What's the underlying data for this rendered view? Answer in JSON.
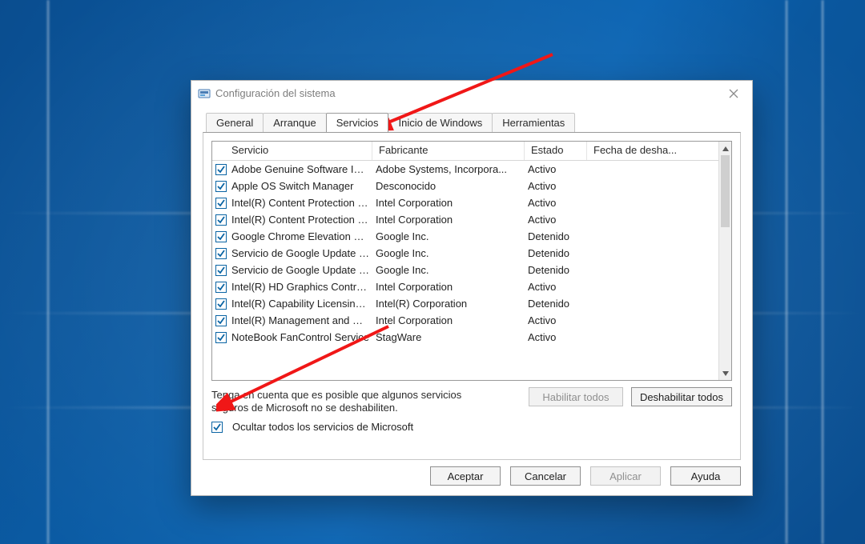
{
  "window": {
    "title": "Configuración del sistema"
  },
  "tabs": [
    "General",
    "Arranque",
    "Servicios",
    "Inicio de Windows",
    "Herramientas"
  ],
  "active_tab_index": 2,
  "columns": {
    "service": "Servicio",
    "manufacturer": "Fabricante",
    "state": "Estado",
    "date": "Fecha de desha..."
  },
  "services": [
    {
      "checked": true,
      "name": "Adobe Genuine Software Integri...",
      "manufacturer": "Adobe Systems, Incorpora...",
      "state": "Activo"
    },
    {
      "checked": true,
      "name": "Apple OS Switch Manager",
      "manufacturer": "Desconocido",
      "state": "Activo"
    },
    {
      "checked": true,
      "name": "Intel(R) Content Protection HEC...",
      "manufacturer": "Intel Corporation",
      "state": "Activo"
    },
    {
      "checked": true,
      "name": "Intel(R) Content Protection HDC...",
      "manufacturer": "Intel Corporation",
      "state": "Activo"
    },
    {
      "checked": true,
      "name": "Google Chrome Elevation Service",
      "manufacturer": "Google Inc.",
      "state": "Detenido"
    },
    {
      "checked": true,
      "name": "Servicio de Google Update (gup...",
      "manufacturer": "Google Inc.",
      "state": "Detenido"
    },
    {
      "checked": true,
      "name": "Servicio de Google Update (gup...",
      "manufacturer": "Google Inc.",
      "state": "Detenido"
    },
    {
      "checked": true,
      "name": "Intel(R) HD Graphics Control Pa...",
      "manufacturer": "Intel Corporation",
      "state": "Activo"
    },
    {
      "checked": true,
      "name": "Intel(R) Capability Licensing Ser...",
      "manufacturer": "Intel(R) Corporation",
      "state": "Detenido"
    },
    {
      "checked": true,
      "name": "Intel(R) Management and Securi...",
      "manufacturer": "Intel Corporation",
      "state": "Activo"
    },
    {
      "checked": true,
      "name": "NoteBook FanControl Service",
      "manufacturer": "StagWare",
      "state": "Activo"
    }
  ],
  "note": "Tenga en cuenta que es posible que algunos servicios seguros de Microsoft no se deshabiliten.",
  "hide_ms": {
    "checked": true,
    "label": "Ocultar todos los servicios de Microsoft"
  },
  "group_buttons": {
    "enable_all": "Habilitar todos",
    "disable_all": "Deshabilitar todos"
  },
  "dialog_buttons": {
    "ok": "Aceptar",
    "cancel": "Cancelar",
    "apply": "Aplicar",
    "help": "Ayuda"
  }
}
